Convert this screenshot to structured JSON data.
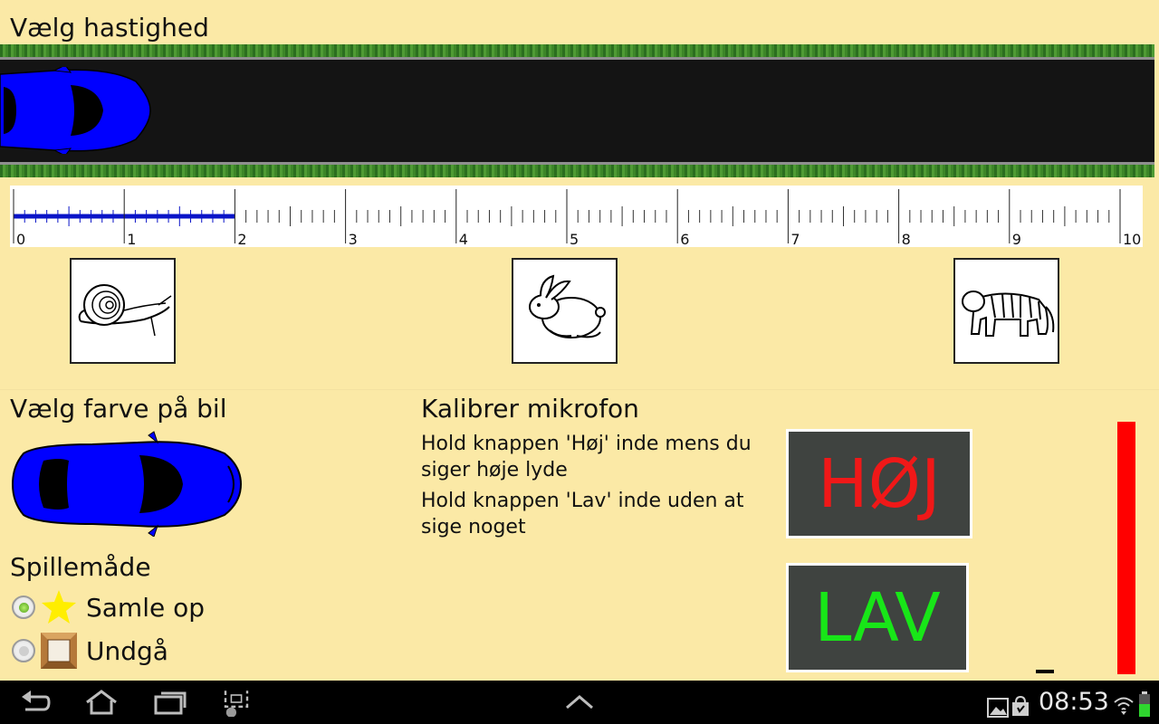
{
  "speed": {
    "title": "Vælg hastighed",
    "ruler_min": 0,
    "ruler_max": 10,
    "ruler_ticks": [
      "0",
      "1",
      "2",
      "3",
      "4",
      "5",
      "6",
      "7",
      "8",
      "9",
      "10"
    ],
    "selected_speed": 2,
    "animals": [
      {
        "icon": "snail-icon",
        "value": 0
      },
      {
        "icon": "rabbit-icon",
        "value": 5
      },
      {
        "icon": "tiger-icon",
        "value": 10
      }
    ]
  },
  "car_color": {
    "title": "Vælg farve på bil",
    "color": "#0000ff"
  },
  "game_mode": {
    "title": "Spillemåde",
    "options": [
      {
        "label": "Samle op",
        "icon": "star-icon",
        "selected": true
      },
      {
        "label": "Undgå",
        "icon": "crate-icon",
        "selected": false
      }
    ]
  },
  "mic": {
    "title": "Kalibrer mikrofon",
    "instruction_high": "Hold knappen 'Høj' inde mens du siger høje lyde",
    "instruction_low": "Hold knappen 'Lav' inde uden at sige noget",
    "high_label": "HØJ",
    "low_label": "LAV",
    "high_color": "#f01818",
    "low_color": "#18e618",
    "level_color": "#ff0000"
  },
  "system_bar": {
    "clock": "08:53",
    "icons": [
      "back-icon",
      "home-icon",
      "recent-apps-icon",
      "screenshot-icon",
      "up-arrow-icon",
      "gallery-icon",
      "shopping-bag-icon",
      "wifi-icon",
      "battery-icon"
    ]
  }
}
